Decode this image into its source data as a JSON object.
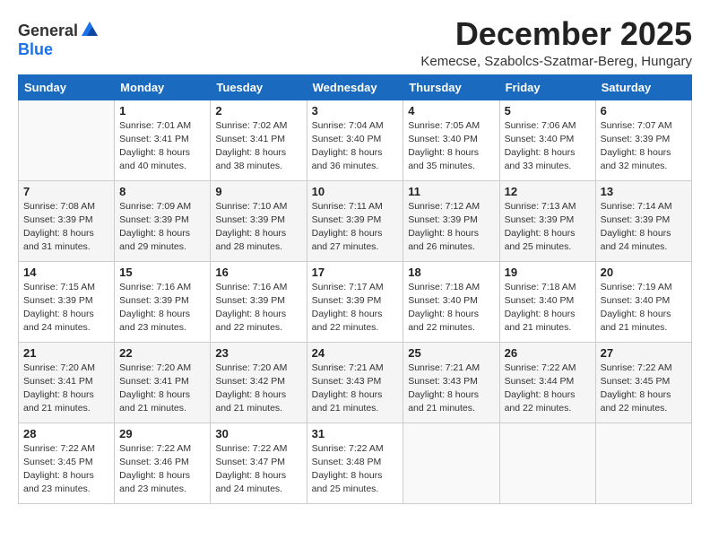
{
  "logo": {
    "general": "General",
    "blue": "Blue"
  },
  "title": "December 2025",
  "location": "Kemecse, Szabolcs-Szatmar-Bereg, Hungary",
  "days_header": [
    "Sunday",
    "Monday",
    "Tuesday",
    "Wednesday",
    "Thursday",
    "Friday",
    "Saturday"
  ],
  "weeks": [
    [
      {
        "day": "",
        "info": ""
      },
      {
        "day": "1",
        "info": "Sunrise: 7:01 AM\nSunset: 3:41 PM\nDaylight: 8 hours\nand 40 minutes."
      },
      {
        "day": "2",
        "info": "Sunrise: 7:02 AM\nSunset: 3:41 PM\nDaylight: 8 hours\nand 38 minutes."
      },
      {
        "day": "3",
        "info": "Sunrise: 7:04 AM\nSunset: 3:40 PM\nDaylight: 8 hours\nand 36 minutes."
      },
      {
        "day": "4",
        "info": "Sunrise: 7:05 AM\nSunset: 3:40 PM\nDaylight: 8 hours\nand 35 minutes."
      },
      {
        "day": "5",
        "info": "Sunrise: 7:06 AM\nSunset: 3:40 PM\nDaylight: 8 hours\nand 33 minutes."
      },
      {
        "day": "6",
        "info": "Sunrise: 7:07 AM\nSunset: 3:39 PM\nDaylight: 8 hours\nand 32 minutes."
      }
    ],
    [
      {
        "day": "7",
        "info": "Sunrise: 7:08 AM\nSunset: 3:39 PM\nDaylight: 8 hours\nand 31 minutes."
      },
      {
        "day": "8",
        "info": "Sunrise: 7:09 AM\nSunset: 3:39 PM\nDaylight: 8 hours\nand 29 minutes."
      },
      {
        "day": "9",
        "info": "Sunrise: 7:10 AM\nSunset: 3:39 PM\nDaylight: 8 hours\nand 28 minutes."
      },
      {
        "day": "10",
        "info": "Sunrise: 7:11 AM\nSunset: 3:39 PM\nDaylight: 8 hours\nand 27 minutes."
      },
      {
        "day": "11",
        "info": "Sunrise: 7:12 AM\nSunset: 3:39 PM\nDaylight: 8 hours\nand 26 minutes."
      },
      {
        "day": "12",
        "info": "Sunrise: 7:13 AM\nSunset: 3:39 PM\nDaylight: 8 hours\nand 25 minutes."
      },
      {
        "day": "13",
        "info": "Sunrise: 7:14 AM\nSunset: 3:39 PM\nDaylight: 8 hours\nand 24 minutes."
      }
    ],
    [
      {
        "day": "14",
        "info": "Sunrise: 7:15 AM\nSunset: 3:39 PM\nDaylight: 8 hours\nand 24 minutes."
      },
      {
        "day": "15",
        "info": "Sunrise: 7:16 AM\nSunset: 3:39 PM\nDaylight: 8 hours\nand 23 minutes."
      },
      {
        "day": "16",
        "info": "Sunrise: 7:16 AM\nSunset: 3:39 PM\nDaylight: 8 hours\nand 22 minutes."
      },
      {
        "day": "17",
        "info": "Sunrise: 7:17 AM\nSunset: 3:39 PM\nDaylight: 8 hours\nand 22 minutes."
      },
      {
        "day": "18",
        "info": "Sunrise: 7:18 AM\nSunset: 3:40 PM\nDaylight: 8 hours\nand 22 minutes."
      },
      {
        "day": "19",
        "info": "Sunrise: 7:18 AM\nSunset: 3:40 PM\nDaylight: 8 hours\nand 21 minutes."
      },
      {
        "day": "20",
        "info": "Sunrise: 7:19 AM\nSunset: 3:40 PM\nDaylight: 8 hours\nand 21 minutes."
      }
    ],
    [
      {
        "day": "21",
        "info": "Sunrise: 7:20 AM\nSunset: 3:41 PM\nDaylight: 8 hours\nand 21 minutes."
      },
      {
        "day": "22",
        "info": "Sunrise: 7:20 AM\nSunset: 3:41 PM\nDaylight: 8 hours\nand 21 minutes."
      },
      {
        "day": "23",
        "info": "Sunrise: 7:20 AM\nSunset: 3:42 PM\nDaylight: 8 hours\nand 21 minutes."
      },
      {
        "day": "24",
        "info": "Sunrise: 7:21 AM\nSunset: 3:43 PM\nDaylight: 8 hours\nand 21 minutes."
      },
      {
        "day": "25",
        "info": "Sunrise: 7:21 AM\nSunset: 3:43 PM\nDaylight: 8 hours\nand 21 minutes."
      },
      {
        "day": "26",
        "info": "Sunrise: 7:22 AM\nSunset: 3:44 PM\nDaylight: 8 hours\nand 22 minutes."
      },
      {
        "day": "27",
        "info": "Sunrise: 7:22 AM\nSunset: 3:45 PM\nDaylight: 8 hours\nand 22 minutes."
      }
    ],
    [
      {
        "day": "28",
        "info": "Sunrise: 7:22 AM\nSunset: 3:45 PM\nDaylight: 8 hours\nand 23 minutes."
      },
      {
        "day": "29",
        "info": "Sunrise: 7:22 AM\nSunset: 3:46 PM\nDaylight: 8 hours\nand 23 minutes."
      },
      {
        "day": "30",
        "info": "Sunrise: 7:22 AM\nSunset: 3:47 PM\nDaylight: 8 hours\nand 24 minutes."
      },
      {
        "day": "31",
        "info": "Sunrise: 7:22 AM\nSunset: 3:48 PM\nDaylight: 8 hours\nand 25 minutes."
      },
      {
        "day": "",
        "info": ""
      },
      {
        "day": "",
        "info": ""
      },
      {
        "day": "",
        "info": ""
      }
    ]
  ]
}
